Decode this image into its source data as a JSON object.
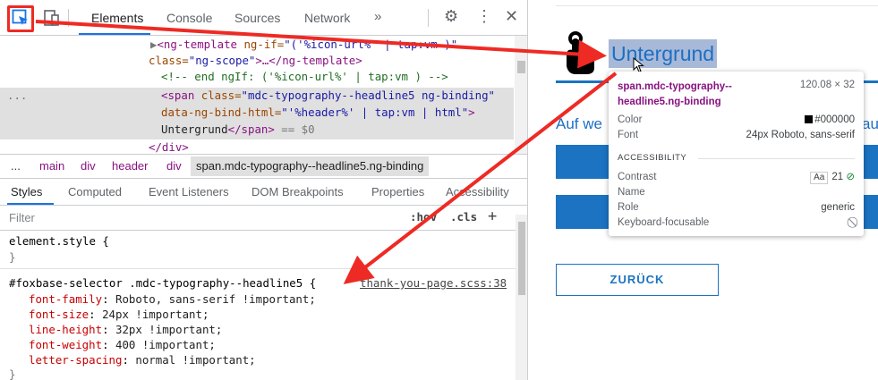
{
  "devtools": {
    "tabs": [
      "Elements",
      "Console",
      "Sources",
      "Network",
      "»"
    ],
    "dom": {
      "line1_tag_open": "<ng-template ",
      "line1_attr": "ng-if=",
      "line1_val": "\"('%icon-url%' | tap:vm )\"",
      "line2_attr": "class=",
      "line2_val": "\"ng-scope\"",
      "line2_rest": ">…</ng-template>",
      "line3_comment": "<!-- end ngIf: ('%icon-url%' | tap:vm ) -->",
      "line4_tag": "<span ",
      "line4_attr": "class=",
      "line4_val": "\"mdc-typography--headline5 ng-binding\"",
      "line5_attr": "data-ng-bind-html=",
      "line5_val": "\"'%header%' | tap:vm | html\"",
      "line5_end": ">",
      "line6_text": "Untergrund",
      "line6_close": "</span>",
      "line6_eq": " == $0",
      "line7": "</div>",
      "ellipsis": "..."
    },
    "breadcrumb": [
      "...",
      "main",
      "div",
      "header",
      "div",
      "span.mdc-typography--headline5.ng-binding"
    ],
    "styles_tabs": [
      "Styles",
      "Computed",
      "Event Listeners",
      "DOM Breakpoints",
      "Properties",
      "Accessibility"
    ],
    "filter": {
      "placeholder": "Filter",
      "hov": ":hov",
      "cls": ".cls",
      "plus": "+"
    },
    "css": {
      "element_style": "element.style {",
      "close": "}",
      "selector": "#foxbase-selector .mdc-typography--headline5 {",
      "source": "thank-you-page.scss:38",
      "props": [
        {
          "name": "font-family",
          "value": "Roboto, sans-serif !important;"
        },
        {
          "name": "font-size",
          "value": "24px !important;"
        },
        {
          "name": "line-height",
          "value": "32px !important;"
        },
        {
          "name": "font-weight",
          "value": "400 !important;"
        },
        {
          "name": "letter-spacing",
          "value": "normal !important;"
        }
      ]
    }
  },
  "page": {
    "headline": "Untergrund",
    "body_text": "Auf we",
    "body_text_right": "au",
    "back_button": "ZURÜCK"
  },
  "tooltip": {
    "selector": "span.mdc-typography--headline5.ng-binding",
    "size": "120.08 × 32",
    "color_label": "Color",
    "color_value": "#000000",
    "font_label": "Font",
    "font_value": "24px Roboto, sans-serif",
    "section": "ACCESSIBILITY",
    "contrast_label": "Contrast",
    "contrast_aa": "Aa",
    "contrast_value": "21",
    "name_label": "Name",
    "role_label": "Role",
    "role_value": "generic",
    "focus_label": "Keyboard-focusable"
  },
  "colors": {
    "accent": "#1a73e8",
    "page_blue": "#1b73c2",
    "annotation_red": "#ee2a24"
  }
}
